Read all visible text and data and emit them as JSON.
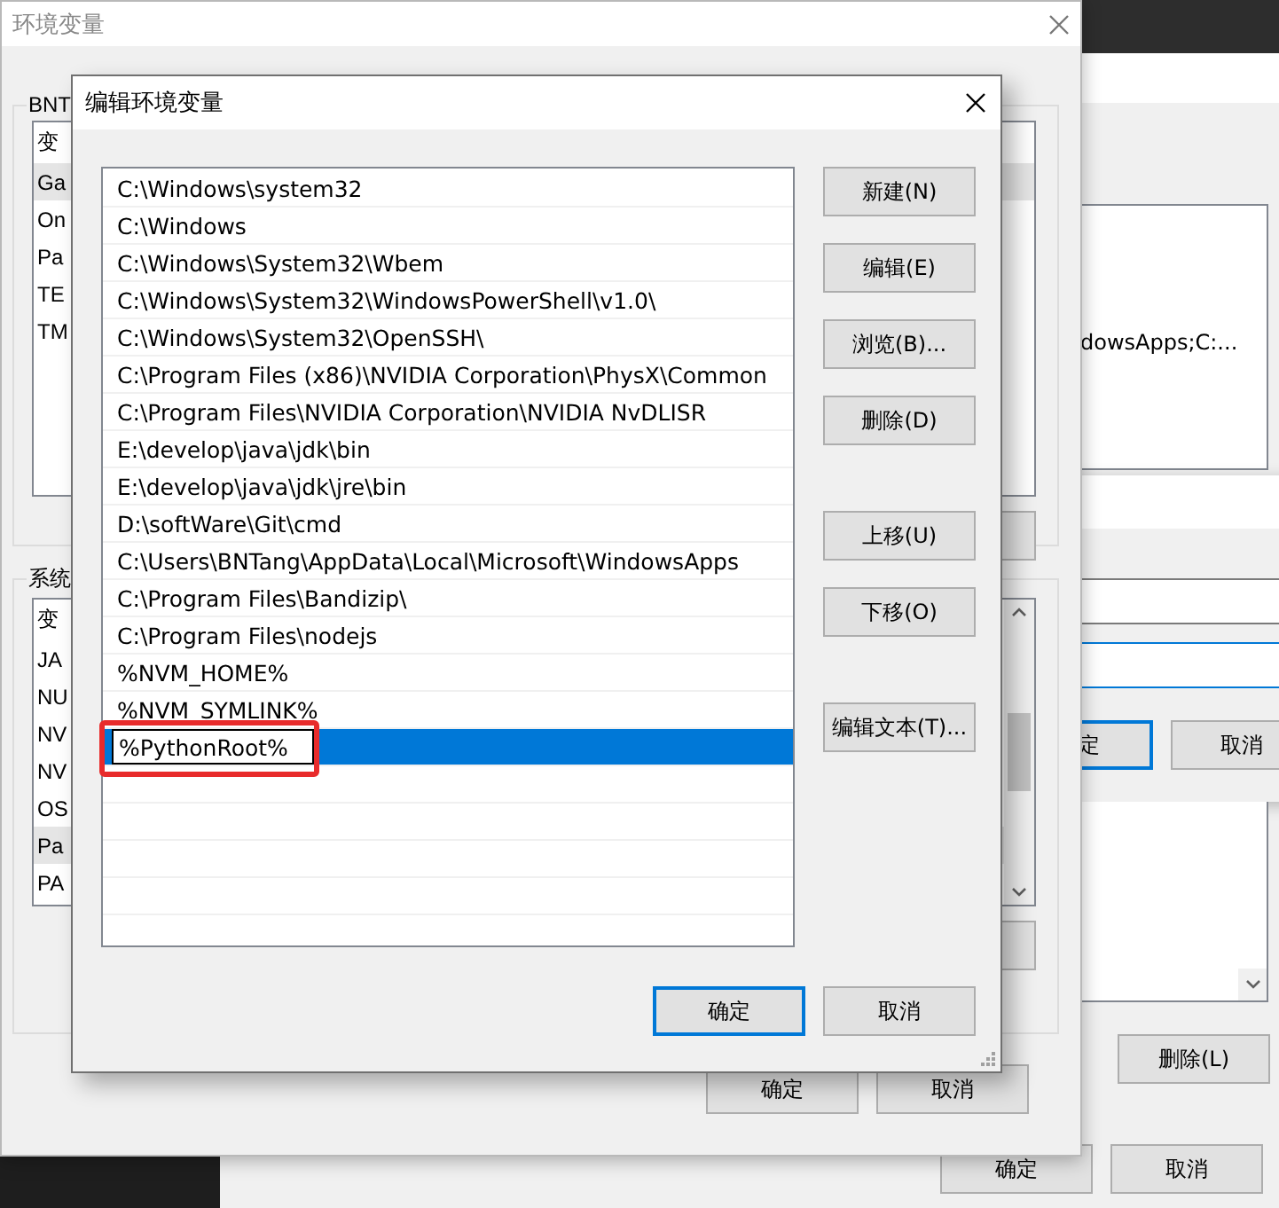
{
  "back_window": {
    "list_text": "dowsApps;C:...",
    "dialog_buttons": [
      {
        "label": "定",
        "default": true
      },
      {
        "label": "取消",
        "default": false
      }
    ],
    "side_button": "删除(L)",
    "buttons": [
      {
        "label": "确定"
      },
      {
        "label": "取消"
      }
    ]
  },
  "env_window": {
    "title": "环境变量",
    "user_group": {
      "title": "BNT",
      "header": "变",
      "rows": [
        {
          "text": "Ga",
          "selected": true
        },
        {
          "text": "On",
          "selected": false
        },
        {
          "text": "Pa",
          "selected": false
        },
        {
          "text": "TE",
          "selected": false
        },
        {
          "text": "TM",
          "selected": false
        }
      ]
    },
    "system_group": {
      "title": "系统",
      "header": "变",
      "rows": [
        {
          "text": "JA",
          "selected": false
        },
        {
          "text": "NU",
          "selected": false
        },
        {
          "text": "NV",
          "selected": false
        },
        {
          "text": "NV",
          "selected": false
        },
        {
          "text": "OS",
          "selected": false
        },
        {
          "text": "Pa",
          "selected": true
        },
        {
          "text": "PA",
          "selected": false
        }
      ]
    },
    "buttons": [
      {
        "label": "确定"
      },
      {
        "label": "取消"
      }
    ]
  },
  "edit_dialog": {
    "title": "编辑环境变量",
    "entries": [
      {
        "text": "C:\\Windows\\system32",
        "selected": false
      },
      {
        "text": "C:\\Windows",
        "selected": false
      },
      {
        "text": "C:\\Windows\\System32\\Wbem",
        "selected": false
      },
      {
        "text": "C:\\Windows\\System32\\WindowsPowerShell\\v1.0\\",
        "selected": false
      },
      {
        "text": "C:\\Windows\\System32\\OpenSSH\\",
        "selected": false
      },
      {
        "text": "C:\\Program Files (x86)\\NVIDIA Corporation\\PhysX\\Common",
        "selected": false
      },
      {
        "text": "C:\\Program Files\\NVIDIA Corporation\\NVIDIA NvDLISR",
        "selected": false
      },
      {
        "text": "E:\\develop\\java\\jdk\\bin",
        "selected": false
      },
      {
        "text": "E:\\develop\\java\\jdk\\jre\\bin",
        "selected": false
      },
      {
        "text": "D:\\softWare\\Git\\cmd",
        "selected": false
      },
      {
        "text": "C:\\Users\\BNTang\\AppData\\Local\\Microsoft\\WindowsApps",
        "selected": false
      },
      {
        "text": "C:\\Program Files\\Bandizip\\",
        "selected": false
      },
      {
        "text": "C:\\Program Files\\nodejs",
        "selected": false
      },
      {
        "text": "%NVM_HOME%",
        "selected": false
      },
      {
        "text": "%NVM_SYMLINK%",
        "selected": false
      },
      {
        "text": "%PythonRoot%",
        "selected": true,
        "editing": true,
        "highlighted": true
      }
    ],
    "side_button_groups": [
      [
        "新建(N)",
        "编辑(E)",
        "浏览(B)...",
        "删除(D)"
      ],
      [
        "上移(U)",
        "下移(O)"
      ],
      [
        "编辑文本(T)..."
      ]
    ],
    "buttons": [
      {
        "label": "确定",
        "default": true
      },
      {
        "label": "取消",
        "default": false
      }
    ]
  }
}
